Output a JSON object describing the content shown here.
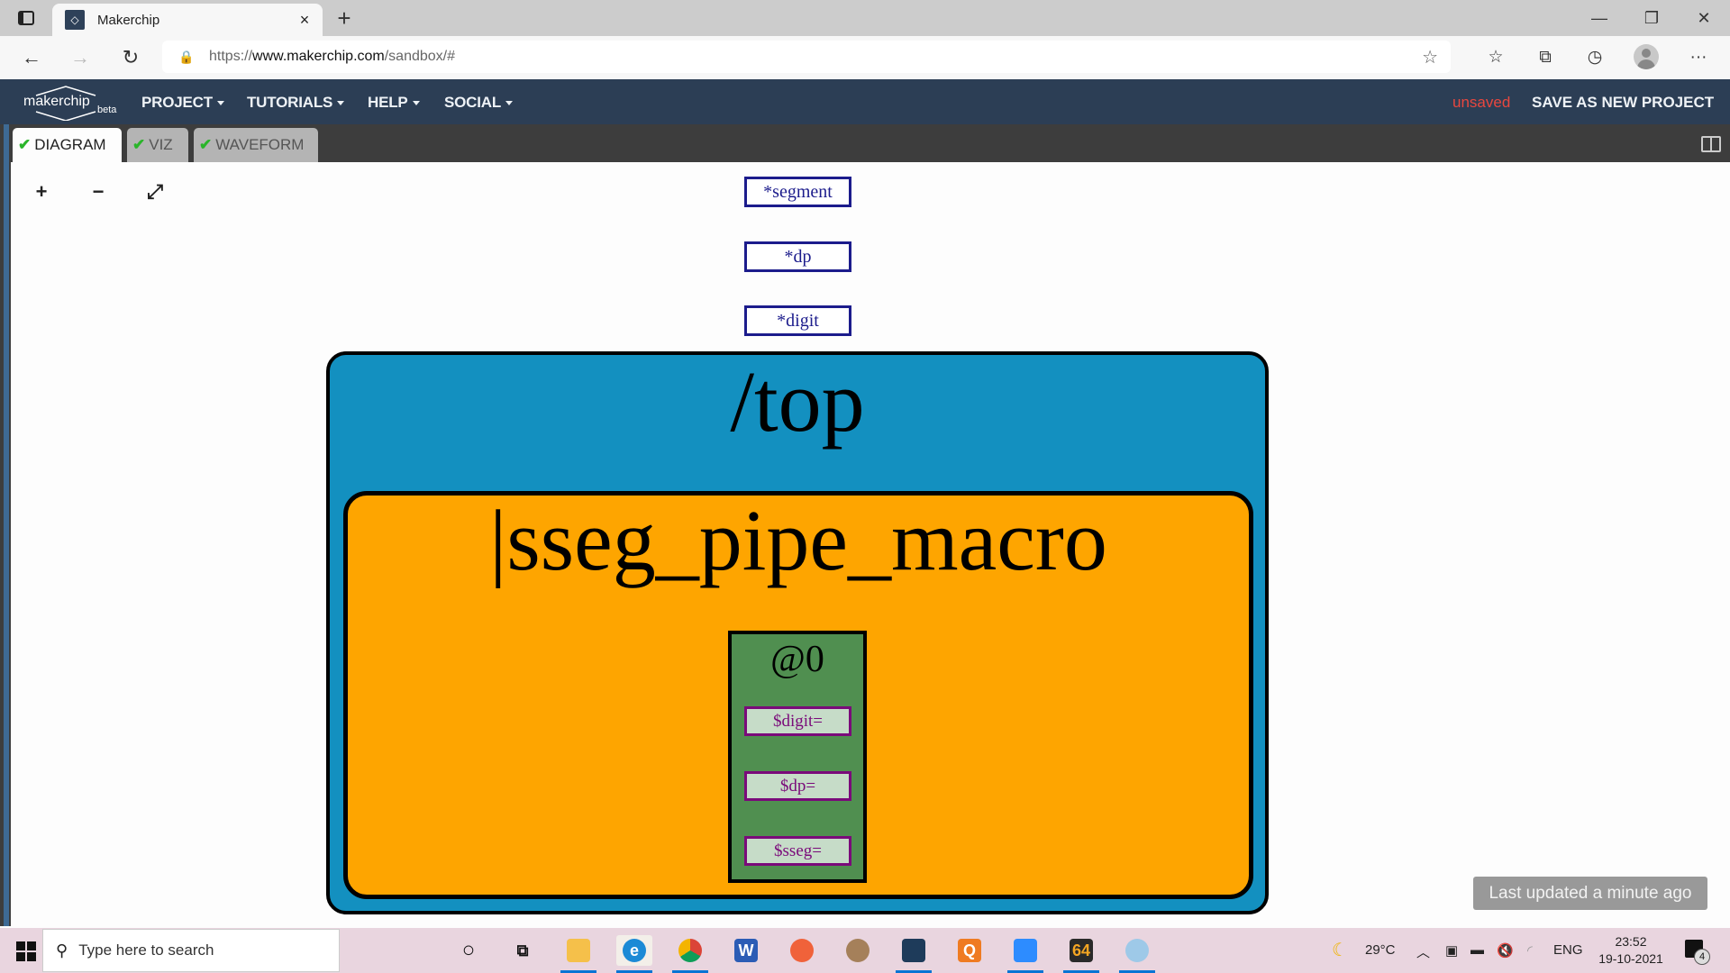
{
  "browser": {
    "tab_title": "Makerchip",
    "url_prefix": "https://",
    "url_domain": "www.makerchip.com",
    "url_path": "/sandbox/#",
    "icons": {
      "tab_actions": "tab-actions-icon",
      "back": "back-arrow-icon",
      "forward": "forward-arrow-icon",
      "refresh": "refresh-icon",
      "lock": "lock-icon",
      "add_favorite": "star-plus-icon",
      "favorites": "favorites-icon",
      "collections": "collections-icon",
      "history": "history-icon",
      "profile": "profile-avatar",
      "more": "more-icon"
    }
  },
  "app": {
    "logo_text": "makerchip",
    "logo_badge": "beta",
    "menu": [
      {
        "label": "PROJECT"
      },
      {
        "label": "TUTORIALS"
      },
      {
        "label": "HELP"
      },
      {
        "label": "SOCIAL"
      }
    ],
    "save_status": "unsaved",
    "save_new_label": "SAVE AS NEW PROJECT",
    "colors": {
      "nav_bg": "#2c3e55",
      "unsaved": "#e8473f",
      "check": "#2ab52a"
    }
  },
  "tabs": [
    {
      "label": "DIAGRAM",
      "active": true
    },
    {
      "label": "VIZ",
      "active": false
    },
    {
      "label": "WAVEFORM",
      "active": false
    }
  ],
  "diagram": {
    "zoom_in": "+",
    "zoom_out": "−",
    "fit": "⤢",
    "external_signals": [
      "*segment",
      "*dp",
      "*digit"
    ],
    "scope": "/top",
    "pipeline": "|sseg_pipe_macro",
    "stage": "@0",
    "stage_signals": [
      "$digit=",
      "$dp=",
      "$sseg="
    ],
    "colors": {
      "scope": "#1390c0",
      "pipeline": "#fea500",
      "stage": "#508f50",
      "signal_border": "#7a0a7a",
      "signal_fill": "#c6dcc8",
      "external_border": "#1c1c8c"
    }
  },
  "toast": "Last updated a minute ago",
  "taskbar": {
    "search_placeholder": "Type here to search",
    "apps": [
      "File Explorer",
      "Microsoft Edge",
      "Google Chrome",
      "Microsoft Word",
      "Firefox",
      "App",
      "VirtualBox",
      "Qlik",
      "Zoom",
      "App 64",
      "Paint"
    ],
    "weather": "29°C",
    "language": "ENG",
    "time": "23:52",
    "date": "19-10-2021",
    "notifications": "4"
  }
}
